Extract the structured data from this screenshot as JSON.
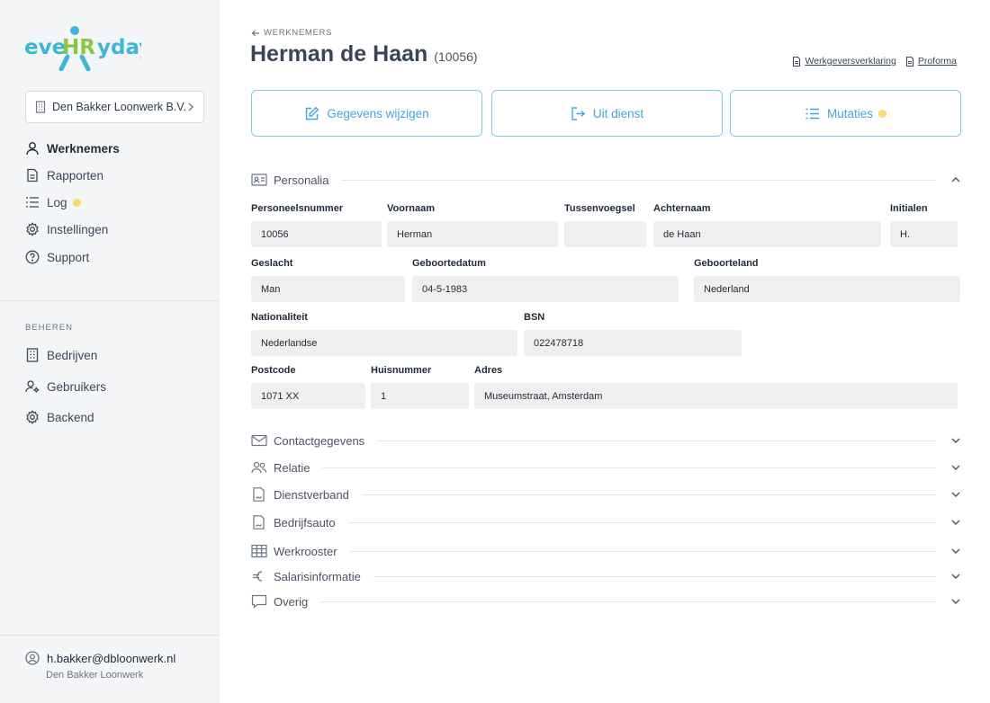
{
  "brand": {
    "logo_text": "eveHRyday",
    "colors": {
      "logo_teal": "#3eb6d6",
      "logo_green": "#8cc63f",
      "accent": "#3ea8d6",
      "accent_border": "#7ec9e3",
      "dot_yellow": "#f6dc6e"
    }
  },
  "sidebar": {
    "company": {
      "label": "Den Bakker Loonwerk B.V.",
      "icon": "building-icon"
    },
    "nav": [
      {
        "label": "Werknemers",
        "icon": "user-icon",
        "active": true
      },
      {
        "label": "Rapporten",
        "icon": "document-icon"
      },
      {
        "label": "Log",
        "icon": "list-icon",
        "dot": true
      },
      {
        "label": "Instellingen",
        "icon": "gear-icon"
      },
      {
        "label": "Support",
        "icon": "help-icon"
      }
    ],
    "manage_heading": "BEHEREN",
    "manage": [
      {
        "label": "Bedrijven",
        "icon": "building-icon"
      },
      {
        "label": "Gebruikers",
        "icon": "users-cog-icon"
      },
      {
        "label": "Backend",
        "icon": "gear-icon"
      }
    ],
    "user": {
      "email": "h.bakker@dbloonwerk.nl",
      "company": "Den Bakker Loonwerk"
    }
  },
  "header": {
    "breadcrumb": "WERKNEMERS",
    "title": "Herman de Haan",
    "employee_id": "(10056)",
    "links": [
      {
        "label": "Werkgeversverklaring",
        "icon": "file-icon"
      },
      {
        "label": "Proforma",
        "icon": "file-icon"
      }
    ]
  },
  "actions": [
    {
      "label": "Gegevens wijzigen",
      "icon": "edit-icon"
    },
    {
      "label": "Uit dienst",
      "icon": "logout-icon"
    },
    {
      "label": "Mutaties",
      "icon": "list-icon",
      "dot": true
    }
  ],
  "personalia": {
    "title": "Personalia",
    "fields": {
      "personeelsnummer": {
        "label": "Personeelsnummer",
        "value": "10056"
      },
      "voornaam": {
        "label": "Voornaam",
        "value": "Herman"
      },
      "tussenvoegsel": {
        "label": "Tussenvoegsel",
        "value": ""
      },
      "achternaam": {
        "label": "Achternaam",
        "value": "de Haan"
      },
      "initialen": {
        "label": "Initialen",
        "value": "H."
      },
      "geslacht": {
        "label": "Geslacht",
        "value": "Man"
      },
      "geboortedatum": {
        "label": "Geboortedatum",
        "value": "04-5-1983"
      },
      "geboorteland": {
        "label": "Geboorteland",
        "value": "Nederland"
      },
      "nationaliteit": {
        "label": "Nationaliteit",
        "value": "Nederlandse"
      },
      "bsn": {
        "label": "BSN",
        "value": "022478718"
      },
      "postcode": {
        "label": "Postcode",
        "value": "1071 XX"
      },
      "huisnummer": {
        "label": "Huisnummer",
        "value": "1"
      },
      "adres": {
        "label": "Adres",
        "value": "Museumstraat, Amsterdam"
      }
    }
  },
  "sections": [
    {
      "title": "Contactgegevens",
      "icon": "mail-icon"
    },
    {
      "title": "Relatie",
      "icon": "people-icon"
    },
    {
      "title": "Dienstverband",
      "icon": "contract-icon"
    },
    {
      "title": "Bedrijfsauto",
      "icon": "car-document-icon"
    },
    {
      "title": "Werkrooster",
      "icon": "table-icon"
    },
    {
      "title": "Salarisinformatie",
      "icon": "euro-icon"
    },
    {
      "title": "Overig",
      "icon": "chat-icon"
    }
  ]
}
